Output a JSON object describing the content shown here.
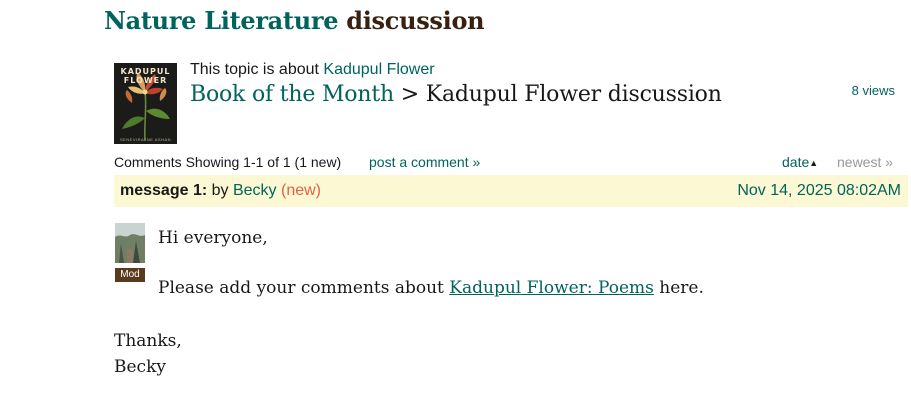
{
  "page": {
    "group_name": "Nature Literature",
    "title_suffix": " discussion"
  },
  "topic": {
    "about_prefix": "This topic is about ",
    "about_book": "Kadupul Flower",
    "breadcrumb_folder": "Book of the Month",
    "breadcrumb_sep": " > ",
    "breadcrumb_current": "Kadupul Flower discussion",
    "views": "8 views"
  },
  "cover": {
    "title_line1": "KADUPUL",
    "title_line2": "FLOWER",
    "author": "SENEVIRATNE ASHAN"
  },
  "comments_bar": {
    "label": "Comments Showing 1-1 of 1 (1 new)",
    "post_comment": "post a comment »",
    "sort_date": "date",
    "sort_newest": "newest »"
  },
  "message": {
    "label": "message 1:",
    "by": " by ",
    "author": "Becky",
    "new_tag": " (new)",
    "date": "Nov 14, 2025 08:02AM",
    "badge": "Mod",
    "line1": "Hi everyone,",
    "line2_prefix": "Please add your comments about ",
    "line2_link": "Kadupul Flower: Poems",
    "line2_suffix": " here.",
    "line3": "Thanks,",
    "line4": "Becky"
  }
}
